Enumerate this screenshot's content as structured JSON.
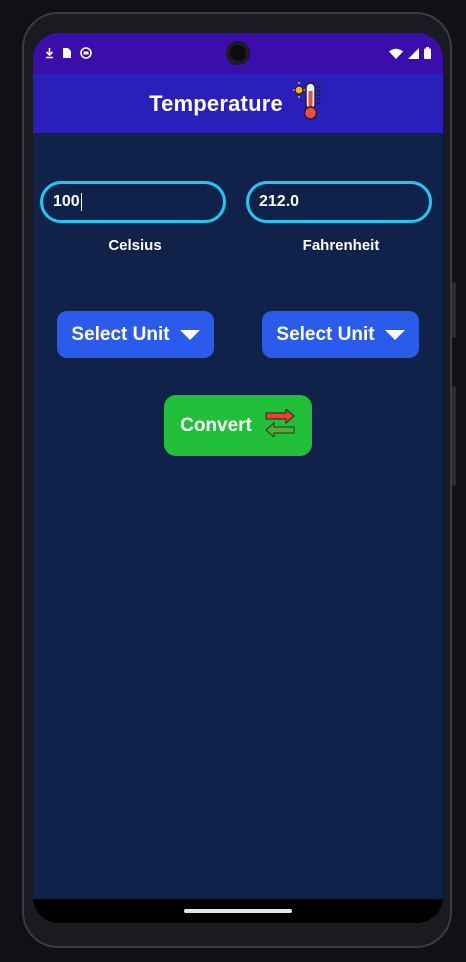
{
  "app": {
    "title": "Temperature",
    "icon": "thermometer-icon"
  },
  "status_bar": {
    "left_icons": [
      "download-icon",
      "sim-card-icon",
      "app-notification-icon"
    ],
    "right_icons": [
      "wifi-icon",
      "signal-icon",
      "battery-icon"
    ]
  },
  "inputs": {
    "celsius": {
      "value": "100",
      "label": "Celsius"
    },
    "fahrenheit": {
      "value": "212.0",
      "label": "Fahrenheit"
    }
  },
  "unit_selectors": {
    "left_label": "Select Unit",
    "right_label": "Select Unit"
  },
  "convert": {
    "label": "Convert",
    "icon": "swap-arrows-icon"
  },
  "colors": {
    "status_bar": "#3b0dab",
    "app_bar": "#2b1fbc",
    "background": "#11224a",
    "field_border": "#1ec9f5",
    "unit_button": "#2a5bea",
    "convert_button": "#22c03a"
  }
}
